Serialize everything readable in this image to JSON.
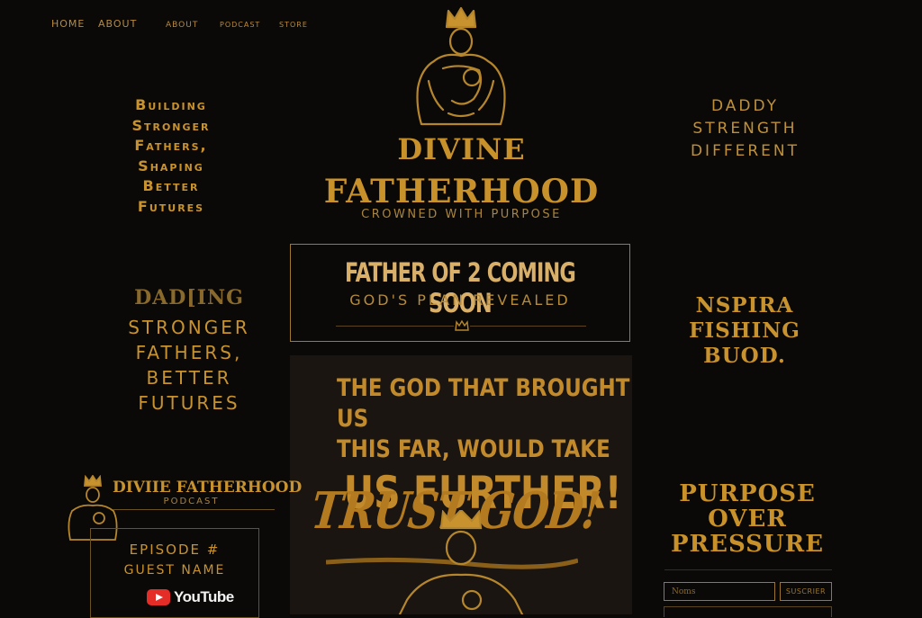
{
  "nav": {
    "items": [
      "HOME",
      "ABOUT",
      "ABOUT",
      "PODCAST",
      "STORE"
    ]
  },
  "brand": {
    "title_line1": "DIVINE",
    "title_line2": "FATHERHOOD",
    "tagline": "CROWNED WITH PURPOSE"
  },
  "left_text_1": "Building\nStronger\nFathers,\nShaping\nBetter\nFutures",
  "right_text_1": "DADDY\nSTRENGTH\nDIFFERENT",
  "left_text_2_heading": "DAD[ING",
  "left_text_2": "STRONGER\nFATHERS,\nBETTER\nFUTURES",
  "right_text_2": "NSPIRA\nFISHING BUOD.",
  "announcement": {
    "title": "FATHER OF 2 COMING SOON",
    "subtitle": "GOD'S PLAN REVEALED"
  },
  "poster": {
    "line1": "THE GOD THAT BROUGHT US",
    "line2": "THIS FAR, WOULD TAKE",
    "line3": "US FURTHER!",
    "line4": "TRUST GOD!"
  },
  "podcast": {
    "title": "DIVIIE FATHERHOOD",
    "subtitle": "PODCAST",
    "episode_label": "EPISODE #",
    "guest_label": "GUEST NAME",
    "youtube_label": "YouTube"
  },
  "purpose": "PURPOSE\nOVER\nPRESSURE",
  "newsletter": {
    "placeholder": "Noms",
    "button_label": "SUSCRIER"
  },
  "colors": {
    "background": "#0b0907",
    "gold": "#c8932e",
    "youtube_red": "#e52d27"
  },
  "icons": [
    "crown-icon",
    "father-child-icon",
    "youtube-icon"
  ]
}
